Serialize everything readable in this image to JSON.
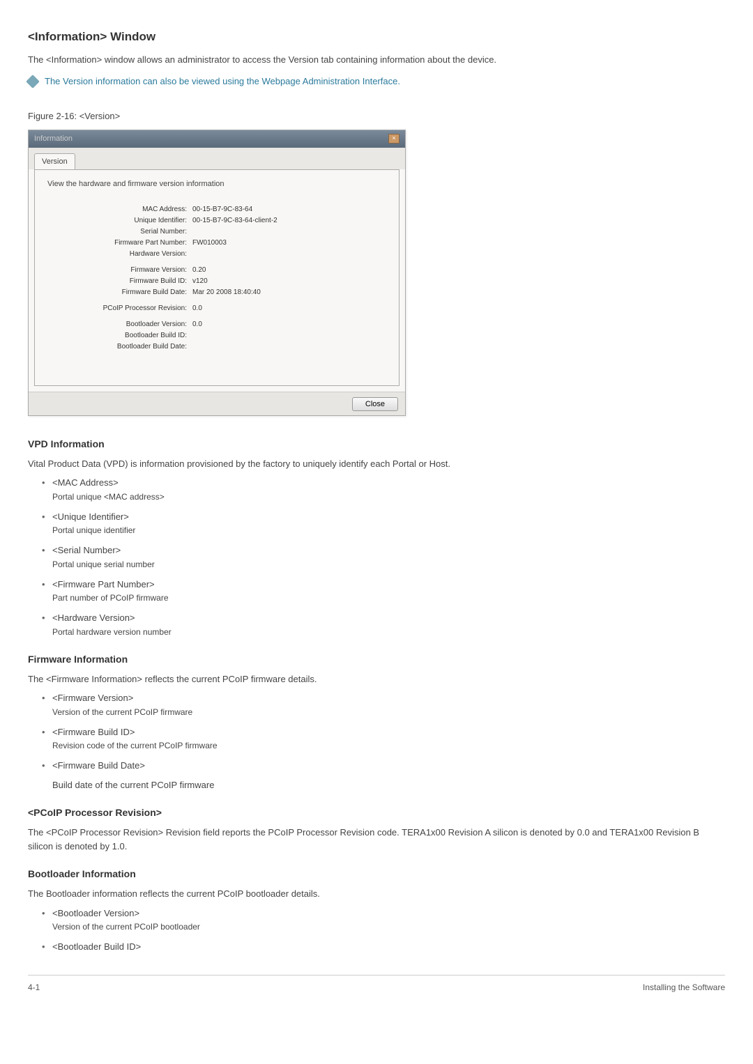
{
  "headings": {
    "main": "<Information> Window",
    "vpd": "VPD Information",
    "firmware": "Firmware Information",
    "proc": "<PCoIP Processor Revision>",
    "boot": "Bootloader Information"
  },
  "paragraphs": {
    "intro": "The <Information> window allows an administrator to access the Version tab containing information about the device.",
    "note": "The Version information can also be viewed using the Webpage Administration Interface.",
    "figure_caption": "Figure 2-16: <Version>",
    "vpd_desc": "Vital Product Data (VPD) is information provisioned by the factory to uniquely identify each Portal or Host.",
    "firmware_desc": "The <Firmware Information> reflects the current PCoIP firmware details.",
    "proc_desc": "The <PCoIP Processor Revision> Revision field reports the PCoIP Processor Revision code. TERA1x00 Revision A silicon is denoted by 0.0 and TERA1x00 Revision B silicon is denoted by 1.0.",
    "boot_desc": "The Bootloader information reflects the current PCoIP bootloader details.",
    "firmware_build_date_desc": "Build date of the current PCoIP firmware"
  },
  "window": {
    "title": "Information",
    "tab_label": "Version",
    "content_header": "View the hardware and firmware version information",
    "close_button": "Close",
    "rows": {
      "mac_label": "MAC Address:",
      "mac_value": "00-15-B7-9C-83-64",
      "uid_label": "Unique Identifier:",
      "uid_value": "00-15-B7-9C-83-64-client-2",
      "serial_label": "Serial Number:",
      "serial_value": "",
      "fwpart_label": "Firmware Part Number:",
      "fwpart_value": "FW010003",
      "hwver_label": "Hardware Version:",
      "hwver_value": "",
      "fwver_label": "Firmware Version:",
      "fwver_value": "0.20",
      "fwbid_label": "Firmware Build ID:",
      "fwbid_value": "v120",
      "fwbdate_label": "Firmware Build Date:",
      "fwbdate_value": "Mar 20 2008 18:40:40",
      "proc_label": "PCoIP Processor Revision:",
      "proc_value": "0.0",
      "blver_label": "Bootloader Version:",
      "blver_value": "0.0",
      "blbid_label": "Bootloader Build ID:",
      "blbid_value": "",
      "blbdate_label": "Bootloader Build Date:",
      "blbdate_value": ""
    }
  },
  "vpd_list": {
    "mac_t": "<MAC Address>",
    "mac_d": "Portal unique <MAC address>",
    "uid_t": "<Unique Identifier>",
    "uid_d": "Portal unique identifier",
    "sn_t": "<Serial Number>",
    "sn_d": "Portal unique serial number",
    "fp_t": "<Firmware Part Number>",
    "fp_d": "Part number of PCoIP firmware",
    "hv_t": "<Hardware Version>",
    "hv_d": "Portal hardware version number"
  },
  "fw_list": {
    "fv_t": "<Firmware Version>",
    "fv_d": "Version of the current PCoIP firmware",
    "fb_t": "<Firmware Build ID>",
    "fb_d": "Revision code of the current PCoIP firmware",
    "fd_t": "<Firmware Build Date>"
  },
  "boot_list": {
    "bv_t": "<Bootloader Version>",
    "bv_d": "Version of the current PCoIP bootloader",
    "bb_t": "<Bootloader Build ID>"
  },
  "footer": {
    "left": "4-1",
    "right": "Installing the Software"
  }
}
